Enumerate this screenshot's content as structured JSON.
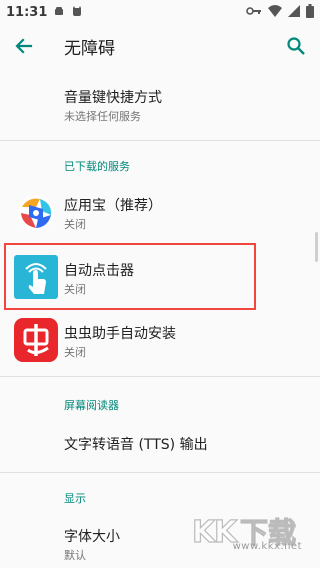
{
  "status_bar": {
    "time": "11:31"
  },
  "app_bar": {
    "title": "无障碍"
  },
  "items": {
    "volume_shortcut": {
      "title": "音量键快捷方式",
      "summary": "未选择任何服务"
    },
    "category_downloaded": "已下载的服务",
    "yingyongbao": {
      "title": "应用宝（推荐）",
      "summary": "关闭"
    },
    "auto_clicker": {
      "title": "自动点击器",
      "summary": "关闭"
    },
    "chongchong": {
      "title": "虫虫助手自动安装",
      "summary": "关闭"
    },
    "category_screen_reader": "屏幕阅读器",
    "tts": {
      "title": "文字转语音 (TTS) 输出"
    },
    "category_display": "显示",
    "font_size": {
      "title": "字体大小",
      "summary": "默认"
    }
  },
  "watermark": {
    "brand": "KK下载",
    "url": "www.kkx.net"
  },
  "colors": {
    "accent": "#00897b",
    "highlight": "#f0463e"
  }
}
